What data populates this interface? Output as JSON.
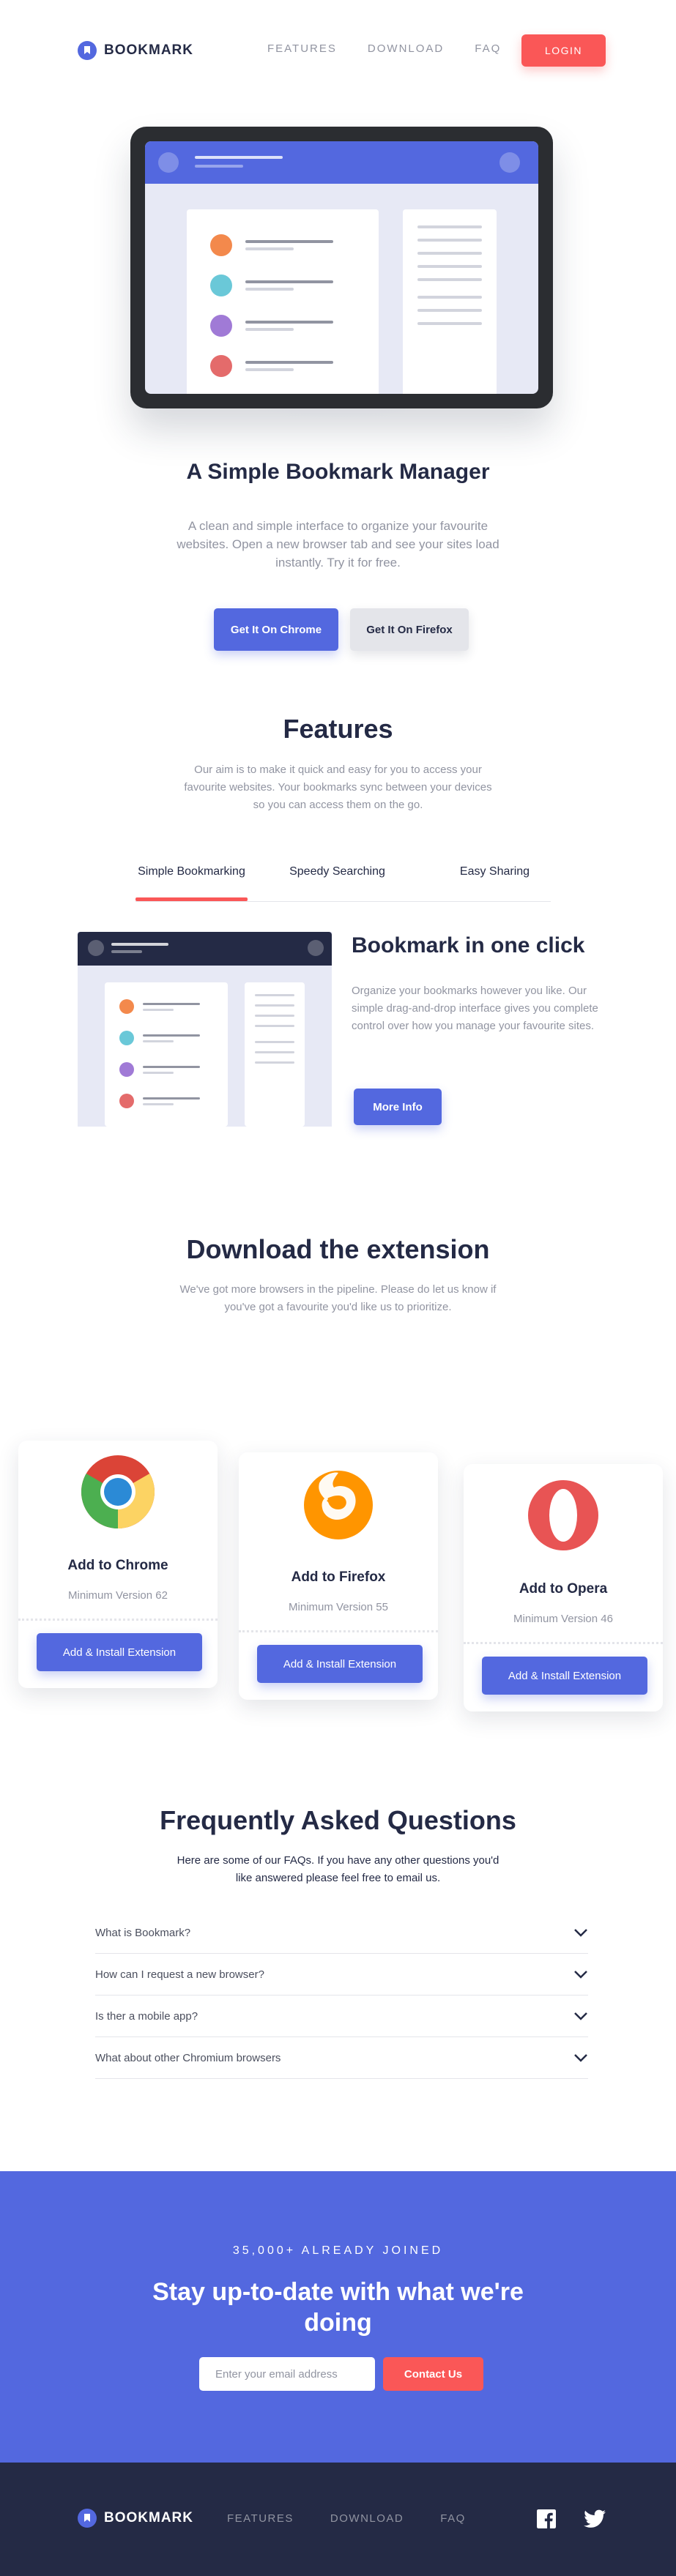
{
  "nav": {
    "logo_text": "BOOKMARK",
    "links": [
      "FEATURES",
      "DOWNLOAD",
      "FAQ"
    ],
    "login": "LOGIN"
  },
  "hero": {
    "title": "A Simple Bookmark Manager",
    "text": "A clean and simple interface to organize your favourite websites. Open a new browser tab and see your sites load instantly. Try it for free.",
    "btn_chrome": "Get It On Chrome",
    "btn_firefox": "Get It On Firefox"
  },
  "features": {
    "title": "Features",
    "text": "Our aim is to make it quick and easy for you to access your favourite websites. Your bookmarks sync between your devices so you can access them on the go.",
    "tabs": [
      "Simple Bookmarking",
      "Speedy Searching",
      "Easy Sharing"
    ],
    "active_tab": 0,
    "panel_title": "Bookmark in one click",
    "panel_text": "Organize your bookmarks however you like. Our simple drag-and-drop interface gives you complete control over how you manage your favourite sites.",
    "more_info": "More Info"
  },
  "download": {
    "title": "Download the extension",
    "text": "We've got more browsers in the pipeline. Please do let us know if you've got a favourite you'd like us to prioritize.",
    "cards": [
      {
        "title": "Add to Chrome",
        "version": "Minimum Version 62",
        "button": "Add & Install Extension",
        "icon": "chrome-icon"
      },
      {
        "title": "Add to Firefox",
        "version": "Minimum Version 55",
        "button": "Add & Install Extension",
        "icon": "firefox-icon"
      },
      {
        "title": "Add to Opera",
        "version": "Minimum Version 46",
        "button": "Add & Install Extension",
        "icon": "opera-icon"
      }
    ]
  },
  "faq": {
    "title": "Frequently Asked Questions",
    "text": "Here are some of our FAQs. If you have any other questions you'd like answered please feel free to email us.",
    "questions": [
      "What is Bookmark?",
      "How can I request a new browser?",
      "Is ther a mobile app?",
      "What about other Chromium browsers"
    ]
  },
  "newsletter": {
    "pre": "35,000+ ALREADY JOINED",
    "title": "Stay up-to-date with what we're doing",
    "placeholder": "Enter your email address",
    "button": "Contact Us"
  },
  "footer": {
    "logo_text": "BOOKMARK",
    "links": [
      "FEATURES",
      "DOWNLOAD",
      "FAQ"
    ],
    "social": [
      "facebook-icon",
      "twitter-icon"
    ]
  },
  "colors": {
    "primary": "#5368df",
    "accent": "#fa5757",
    "dark": "#242a45",
    "muted": "#9194a1"
  }
}
